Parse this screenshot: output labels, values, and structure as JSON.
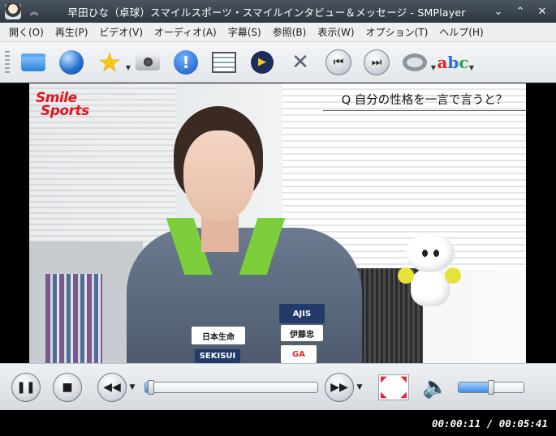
{
  "window": {
    "title": "早田ひな（卓球）スマイルスポーツ・スマイルインタビュー＆メッセージ - SMPlayer"
  },
  "menu": [
    "開く(O)",
    "再生(P)",
    "ビデオ(V)",
    "オーディオ(A)",
    "字幕(S)",
    "参照(B)",
    "表示(W)",
    "オプション(T)",
    "ヘルプ(H)"
  ],
  "toolbar_icons": [
    "folder-icon",
    "globe-icon",
    "star-icon",
    "camera-icon",
    "info-icon",
    "playlist-icon",
    "video-settings-icon",
    "tools-icon",
    "previous-icon",
    "next-icon",
    "audio-ring-icon",
    "subtitle-abc-icon"
  ],
  "video": {
    "logo_line1": "Smile",
    "logo_line2": "Sports",
    "caption": "Q 自分の性格を一言で言うと？",
    "patches": {
      "brand_top": "AJIS",
      "sponsor_left": "日本生命",
      "sponsor_bottom": "SEKISUI",
      "sponsor_right": "GA",
      "sponsor_mid": "伊藤忠"
    }
  },
  "controls": {
    "seek_fraction": 0.033,
    "volume_fraction": 0.5
  },
  "status": {
    "time": "00:00:11 / 00:05:41"
  },
  "colors": {
    "logo": "#e0161e",
    "accent_seek": "#3f8ae3",
    "jacket_trim": "#7ccf3a"
  }
}
